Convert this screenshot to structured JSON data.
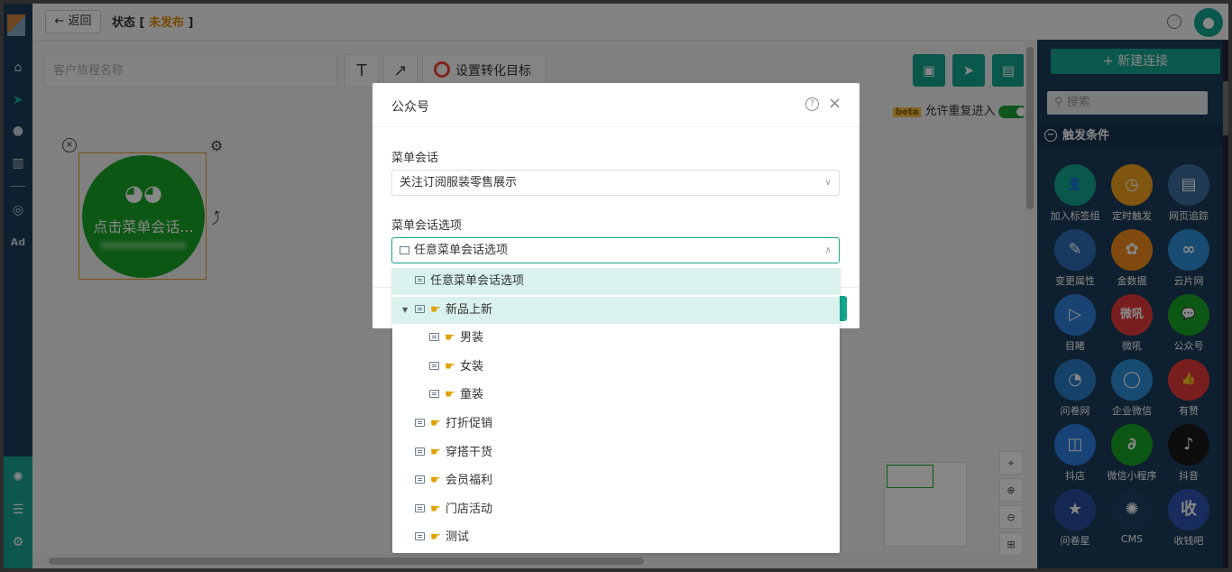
{
  "topbar": {
    "back_label": "← 返回",
    "status_prefix": "状态 [ ",
    "status_value": "未发布",
    "status_suffix": " ]"
  },
  "toolbar": {
    "journey_placeholder": "客户旅程名称",
    "text_tool": "T",
    "arrow_tool": "↗",
    "goal_label": "设置转化目标",
    "allow_reentry": "允许重复进入",
    "beta": "beta"
  },
  "canvas": {
    "node_label": "点击菜单会话..."
  },
  "right_panel": {
    "new_connection": "+ 新建连接",
    "search_placeholder": "搜索",
    "section": "触发条件",
    "tiles": [
      {
        "label": "加入标签组",
        "color": "#14a58f",
        "icon": "👤"
      },
      {
        "label": "定时触发",
        "color": "#f0a11d",
        "icon": "◷"
      },
      {
        "label": "网页追踪",
        "color": "#3d6e9e",
        "icon": "▤"
      },
      {
        "label": "变更属性",
        "color": "#2f6fb5",
        "icon": "✎"
      },
      {
        "label": "金数据",
        "color": "#f08a1d",
        "icon": "✿"
      },
      {
        "label": "云片网",
        "color": "#2c8ed6",
        "icon": "∞"
      },
      {
        "label": "目睹",
        "color": "#2e7fd8",
        "icon": "▷"
      },
      {
        "label": "微吼",
        "color": "#e4393c",
        "icon": "微吼"
      },
      {
        "label": "公众号",
        "color": "#19a529",
        "icon": "💬"
      },
      {
        "label": "问卷网",
        "color": "#2a7ec9",
        "icon": "◔"
      },
      {
        "label": "企业微信",
        "color": "#2c8ed6",
        "icon": "◯"
      },
      {
        "label": "有赞",
        "color": "#e4393c",
        "icon": "👍"
      },
      {
        "label": "抖店",
        "color": "#2c7fe0",
        "icon": "◫"
      },
      {
        "label": "微信小程序",
        "color": "#19a529",
        "icon": "∂"
      },
      {
        "label": "抖音",
        "color": "#1a1a1a",
        "icon": "♪"
      },
      {
        "label": "问卷星",
        "color": "#2a4fa0",
        "icon": "★"
      },
      {
        "label": "CMS",
        "color": "#1d3f60",
        "icon": "✺"
      },
      {
        "label": "收钱吧",
        "color": "#2f56b0",
        "icon": "收"
      }
    ]
  },
  "modal": {
    "title": "公众号",
    "menu_session_label": "菜单会话",
    "menu_session_value": "关注订阅服装零售展示",
    "menu_option_label": "菜单会话选项",
    "menu_option_value": "任意菜单会话选项",
    "options": [
      {
        "label": "任意菜单会话选项",
        "level": 0,
        "hand": false,
        "highlight": true
      },
      {
        "label": "新品上新",
        "level": 0,
        "hand": true,
        "highlight": true,
        "expanded": true
      },
      {
        "label": "男装",
        "level": 1,
        "hand": true,
        "highlight": false
      },
      {
        "label": "女装",
        "level": 1,
        "hand": true,
        "highlight": false
      },
      {
        "label": "童装",
        "level": 1,
        "hand": true,
        "highlight": false
      },
      {
        "label": "打折促销",
        "level": 0,
        "hand": true,
        "highlight": false
      },
      {
        "label": "穿搭干货",
        "level": 0,
        "hand": true,
        "highlight": false
      },
      {
        "label": "会员福利",
        "level": 0,
        "hand": true,
        "highlight": false
      },
      {
        "label": "门店活动",
        "level": 0,
        "hand": true,
        "highlight": false
      },
      {
        "label": "测试",
        "level": 0,
        "hand": true,
        "highlight": false
      }
    ]
  },
  "colors": {
    "accent": "#14a58f",
    "nav": "#1c3d5a",
    "wechat": "#19a529",
    "status": "#e08a00"
  }
}
